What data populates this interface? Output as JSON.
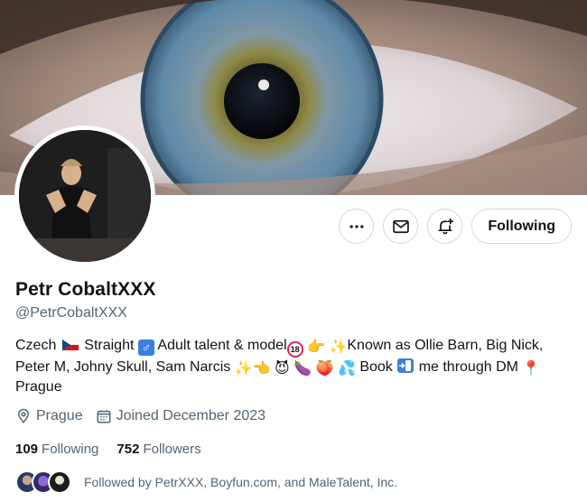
{
  "profile": {
    "display_name": "Petr CobaltXXX",
    "handle": "@PetrCobaltXXX",
    "bio": {
      "line1_czech": "Czech",
      "line1_straight": "Straight",
      "line1_adult": "Adult talent & model",
      "line1_known": "Known as Ollie Barn, Big",
      "line2_names": "Nick, Peter M, Johny Skull, Sam Narcis",
      "line2_book": "Book",
      "line2_me": "me through",
      "line3_dm": "DM",
      "line3_city": "Prague"
    },
    "location": "Prague",
    "joined": "Joined December 2023",
    "following_count": "109",
    "following_label": "Following",
    "followers_count": "752",
    "followers_label": "Followers",
    "followed_by": "Followed by PetrXXX, Boyfun.com, and MaleTalent, Inc."
  },
  "actions": {
    "more_icon": "more-horizontal-icon",
    "message_icon": "envelope-icon",
    "notify_icon": "bell-plus-icon",
    "follow_label": "Following"
  },
  "colors": {
    "text_primary": "#0f1419",
    "text_secondary": "#536471",
    "border": "#cfd9de"
  }
}
